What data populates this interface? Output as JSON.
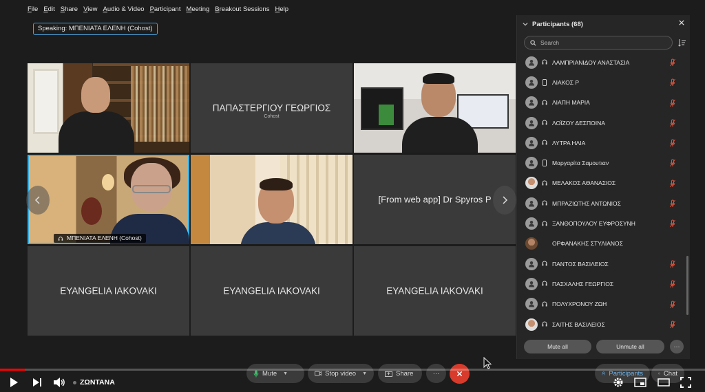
{
  "menu": [
    "File",
    "Edit",
    "Share",
    "View",
    "Audio & Video",
    "Participant",
    "Meeting",
    "Breakout Sessions",
    "Help"
  ],
  "speaking": "Speaking: ΜΠΕΝΙΑΤΑ ΕΛΕΝΗ (Cohost)",
  "grid": {
    "tile2_name": "ΠΑΠΑΣΤΕΡΓΙΟΥ ΓΕΩΡΓΙΟΣ",
    "tile2_role": "Cohost",
    "tile4_label": "ΜΠΕΝΙΑΤΑ ΕΛΕΝΗ (Cohost)",
    "tile6_name": "[From web app] Dr Spyros P",
    "tile7_name": "EYANGELIA IAKOVAKI",
    "tile8_name": "EYANGELIA IAKOVAKI",
    "tile9_name": "EYANGELIA IAKOVAKI",
    "prev_icon": "chevron-left-icon",
    "next_icon": "chevron-right-icon"
  },
  "participants": {
    "title": "Participants (68)",
    "search_placeholder": "Search",
    "list": [
      {
        "name": "ΛΑΜΠΡΙΑΝΙΔΟΥ ΑΝΑΣΤΑΣΙΑ",
        "device": "headset-icon",
        "avatar": "default",
        "muted": true
      },
      {
        "name": "ΛΙΑΚΟΣ Ρ",
        "device": "phone-icon",
        "avatar": "default",
        "muted": true
      },
      {
        "name": "ΛΙΑΠΗ ΜΑΡΙΑ",
        "device": "headset-icon",
        "avatar": "default",
        "muted": true
      },
      {
        "name": "ΛΟΪΖΟΥ ΔΕΣΠΟΙΝΑ",
        "device": "headset-icon",
        "avatar": "default",
        "muted": true
      },
      {
        "name": "ΛΥΤΡΑ ΗΛΙΑ",
        "device": "headset-icon",
        "avatar": "default",
        "muted": true
      },
      {
        "name": "Μαργαρίτα Σαμουτιαν",
        "device": "phone-icon",
        "avatar": "default",
        "muted": true
      },
      {
        "name": "ΜΕΛΑΚΟΣ ΑΘΑΝΑΣΙΟΣ",
        "device": "headset-icon",
        "avatar": "photo",
        "muted": true
      },
      {
        "name": "ΜΠΡΑΖΙΩΤΗΣ ΑΝΤΩΝΙΟΣ",
        "device": "headset-icon",
        "avatar": "default",
        "muted": true
      },
      {
        "name": "ΞΑΝΘΟΠΟΥΛΟΥ ΕΥΦΡΟΣΥΝΗ",
        "device": "headset-icon",
        "avatar": "default",
        "muted": true
      },
      {
        "name": "ΟΡΦΑΝΑΚΗΣ ΣΤΥΛΙΑΝΟΣ",
        "device": "",
        "avatar": "photo2",
        "muted": false
      },
      {
        "name": "ΠΑΝΤΟΣ ΒΑΣΙΛΕΙΟΣ",
        "device": "headset-icon",
        "avatar": "default",
        "muted": true
      },
      {
        "name": "ΠΑΣΧΑΛΗΣ ΓΕΩΡΓΙΟΣ",
        "device": "headset-icon",
        "avatar": "default",
        "muted": true
      },
      {
        "name": "ΠΟΛΥΧΡΟΝΟΥ ΖΩΗ",
        "device": "headset-icon",
        "avatar": "default",
        "muted": true
      },
      {
        "name": "ΣΑΙΤΗΣ ΒΑΣΙΛΕΙΟΣ",
        "device": "headset-icon",
        "avatar": "photo",
        "muted": true
      }
    ],
    "mute_all": "Mute all",
    "unmute_all": "Unmute all",
    "more": "···"
  },
  "controls": {
    "mute": "Mute",
    "stop_video": "Stop video",
    "share": "Share",
    "more": "···",
    "participants": "Participants",
    "chat": "Chat"
  },
  "youtube": {
    "live_label": "ΖΩΝΤΑΝΑ",
    "progress": 0.035,
    "colors": {
      "progress": "#ff0000",
      "end_call": "#d83b2b",
      "active_border": "#38b2e8",
      "muted_mic": "#e0533d"
    }
  }
}
